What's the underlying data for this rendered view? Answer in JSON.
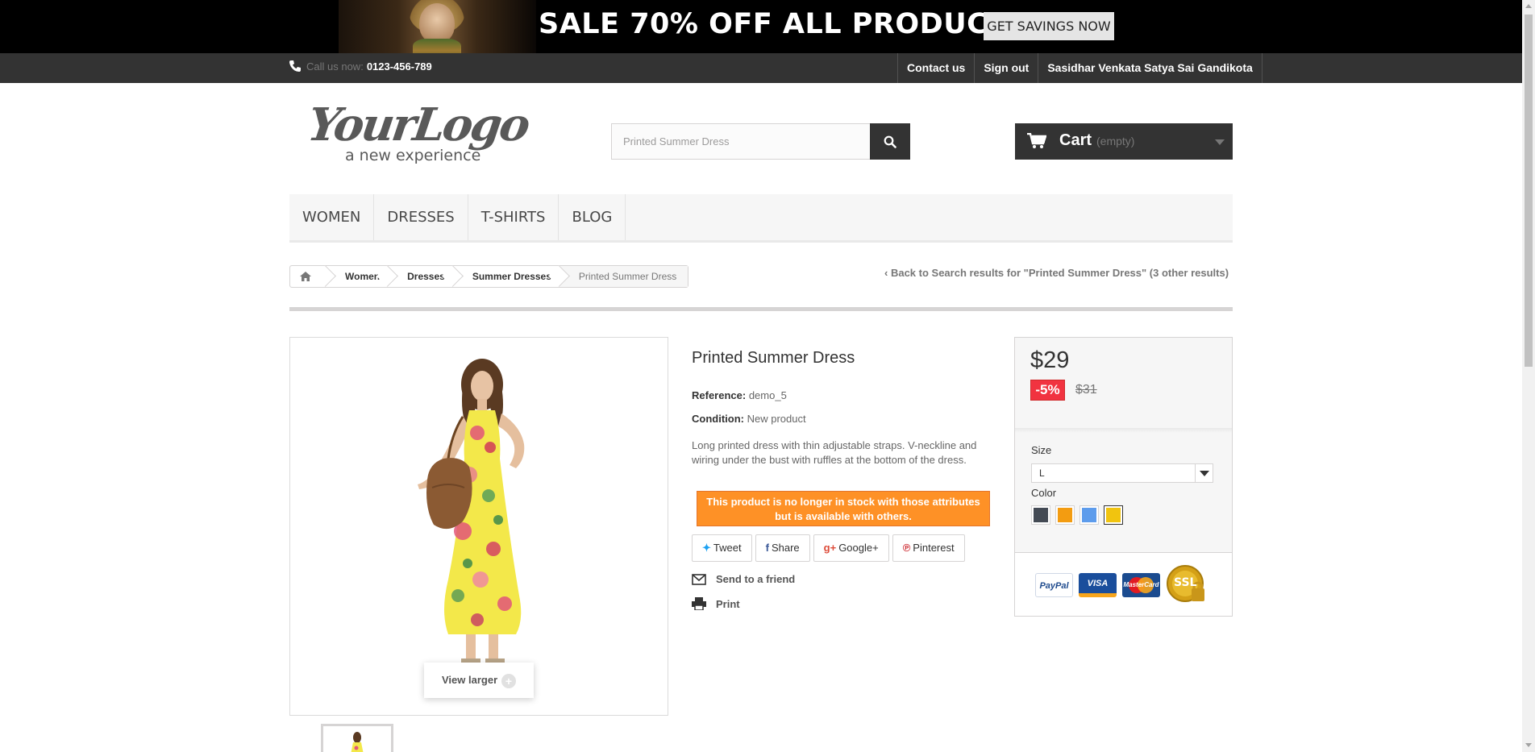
{
  "banner": {
    "text": "SALE 70% OFF ALL PRODUCTS",
    "button": "GET SAVINGS NOW"
  },
  "topbar": {
    "call_label": "Call us now:",
    "phone": "0123-456-789",
    "links": [
      "Contact us",
      "Sign out",
      "Sasidhar Venkata Satya Sai Gandikota"
    ]
  },
  "logo": {
    "main": "YourLogo",
    "tagline": "a new experience"
  },
  "search": {
    "value": "Printed Summer Dress"
  },
  "cart": {
    "label": "Cart",
    "status": "(empty)"
  },
  "menu": [
    "WOMEN",
    "DRESSES",
    "T-SHIRTS",
    "BLOG"
  ],
  "breadcrumb": [
    "Women",
    "Dresses",
    "Summer Dresses",
    "Printed Summer Dress"
  ],
  "back_link": "Back to Search results for \"Printed Summer Dress\" (3 other results)",
  "product": {
    "title": "Printed Summer Dress",
    "reference_label": "Reference:",
    "reference": "demo_5",
    "condition_label": "Condition:",
    "condition": "New product",
    "description": "Long printed dress with thin adjustable straps. V-neckline and wiring under the bust with ruffles at the bottom of the dress.",
    "stock_message": "This product is no longer in stock with those attributes but is available with others.",
    "view_larger": "View larger"
  },
  "social": [
    "Tweet",
    "Share",
    "Google+",
    "Pinterest"
  ],
  "actions": {
    "send": "Send to a friend",
    "print": "Print"
  },
  "buy": {
    "price": "$29",
    "discount": "-5%",
    "old_price": "$31",
    "size_label": "Size",
    "size_value": "L",
    "color_label": "Color",
    "colors": [
      "#434a54",
      "#f39c11",
      "#5d9cec",
      "#f1c40f"
    ],
    "selected_color": "#f1c40f"
  },
  "payments": [
    "PayPal",
    "VISA",
    "MasterCard",
    "SSL"
  ]
}
